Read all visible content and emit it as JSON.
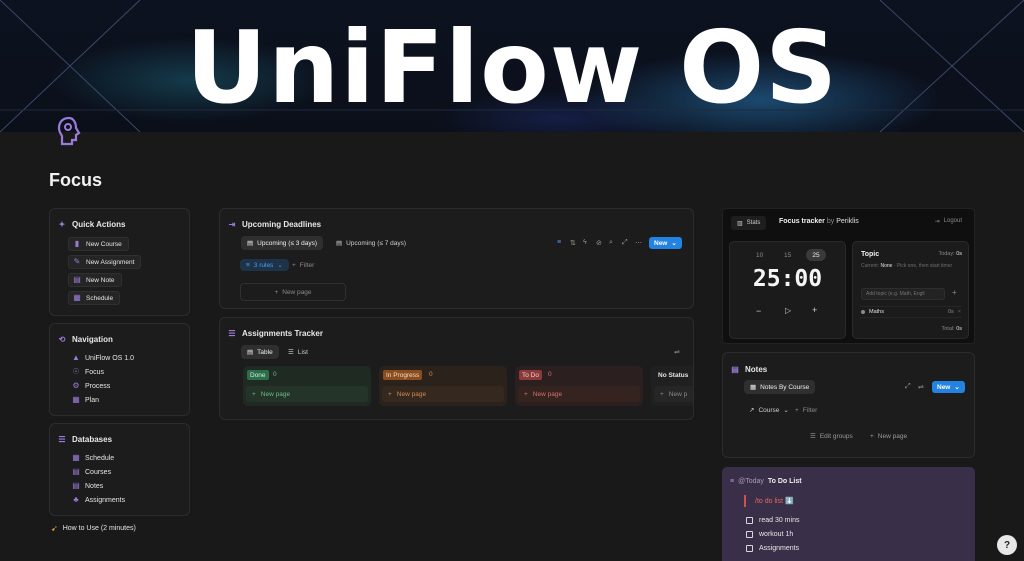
{
  "banner": {
    "title": "UniFlow OS"
  },
  "page": {
    "title": "Focus"
  },
  "quick_actions": {
    "title": "Quick Actions",
    "buttons": [
      "New Course",
      "New Assignment",
      "New Note",
      "Schedule"
    ]
  },
  "navigation": {
    "title": "Navigation",
    "items": [
      "UniFlow OS 1.0",
      "Focus",
      "Process",
      "Plan"
    ]
  },
  "databases": {
    "title": "Databases",
    "items": [
      "Schedule",
      "Courses",
      "Notes",
      "Assignments"
    ]
  },
  "how_to": {
    "label": "How to Use (2 minutes)"
  },
  "deadlines": {
    "title": "Upcoming Deadlines",
    "tabs": [
      "Upcoming (≤ 3 days)",
      "Upcoming (≤ 7 days)"
    ],
    "rules_label": "3 rules",
    "filter_label": "Filter",
    "new_label": "New",
    "new_page_label": "New page"
  },
  "assignments": {
    "title": "Assignments Tracker",
    "views": [
      "Table",
      "List"
    ],
    "columns": [
      {
        "label": "Done",
        "count": "0",
        "new_page": "New page",
        "color": "#2c6e49"
      },
      {
        "label": "In Progress",
        "count": "0",
        "new_page": "New page",
        "color": "#8a4d1f"
      },
      {
        "label": "To Do",
        "count": "0",
        "new_page": "New page",
        "color": "#8a3a38"
      },
      {
        "label": "No Status",
        "count": "",
        "new_page": "New p"
      }
    ]
  },
  "focus_tracker": {
    "stats_label": "Stats",
    "title": "Focus tracker",
    "by_label": "by",
    "author": "Periklis",
    "logout_label": "Logout",
    "presets": [
      "10",
      "15",
      "25"
    ],
    "time": "25:00",
    "topic_label": "Topic",
    "today_label": "Today:",
    "today_value": "0s",
    "current_label": "Current:",
    "current_value": "None",
    "current_hint": "· Pick one, then start timer",
    "topic_placeholder": "Add topic (e.g. Math, Engli",
    "topics": [
      {
        "name": "Maths",
        "time": "0s"
      }
    ],
    "total_label": "Total:",
    "total_value": "0s"
  },
  "notes": {
    "title": "Notes",
    "view_label": "Notes By Course",
    "new_label": "New",
    "course_filter": "Course",
    "filter_label": "Filter",
    "edit_groups": "Edit groups",
    "new_page": "New page"
  },
  "todo": {
    "at_label": "@Today",
    "title": "To Do List",
    "command": "/to do list ⬇️",
    "items": [
      "read 30 mins",
      "workout 1h",
      "Assignments"
    ]
  },
  "help": {
    "label": "?"
  },
  "colors": {
    "accent": "#2383e2",
    "purple": "#9b7bd8"
  }
}
